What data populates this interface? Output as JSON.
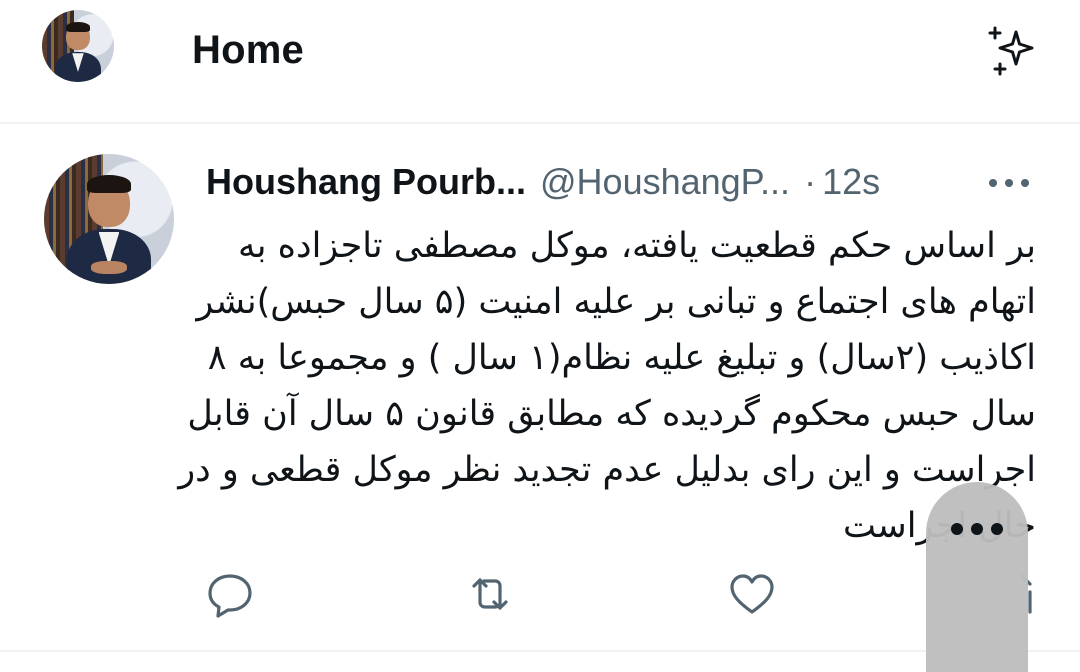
{
  "header": {
    "title": "Home"
  },
  "tweet": {
    "display_name": "Houshang Pourb...",
    "handle": "@HoushangP...",
    "separator": "·",
    "time": "12s",
    "text_lines": [
      "بر اساس حکم قطعیت یافته، موکل مصطفی تاجزاده به",
      "اتهام های اجتماع و تبانی بر علیه امنیت (۵ سال حبس)نشر",
      "اکاذیب (۲سال) و تبلیغ علیه نظام(۱ سال ) و مجموعا به ۸",
      "سال حبس محکوم گردیده  که مطابق قانون ۵ سال آن قابل",
      "اجراست و این رای بدلیل عدم تجدید نظر موکل قطعی و در",
      "حال اجراست"
    ]
  },
  "icons": {
    "sparkle": "sparkle-icon",
    "more": "more-options-icon",
    "reply": "reply-icon",
    "retweet": "retweet-icon",
    "like": "heart-icon",
    "share": "share-icon",
    "overlay_more": "more-horizontal-icon"
  },
  "colors": {
    "text": "#0f1419",
    "secondary": "#536471",
    "divider": "#eff3f4",
    "overlay": "#bdbdbd"
  }
}
